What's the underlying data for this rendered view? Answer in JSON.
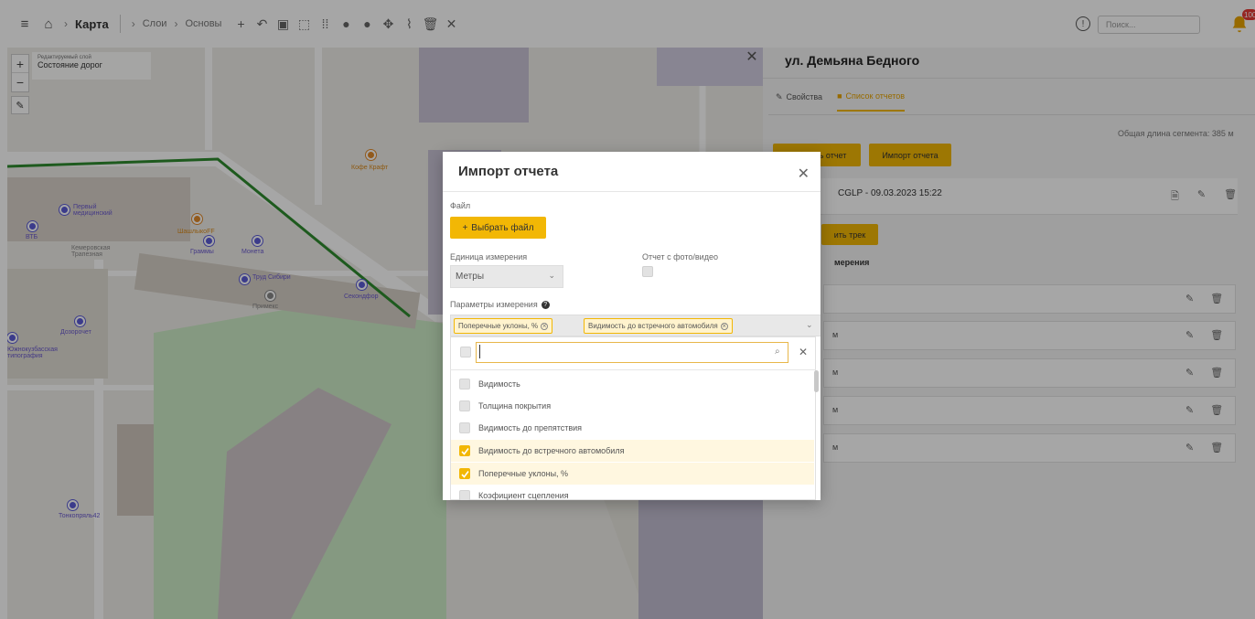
{
  "topbar": {
    "breadcrumb": [
      {
        "label": "Карта",
        "bold": true
      },
      {
        "label": "Слои",
        "bold": false
      },
      {
        "label": "Основы",
        "bold": false
      }
    ],
    "search_placeholder": "Поиск...",
    "notifications_badge": "100",
    "tool_icons": [
      "plus-icon",
      "undo-icon",
      "save-icon",
      "select-rect-icon",
      "grid-icon",
      "point-icon",
      "point-filled-icon",
      "move-icon",
      "line-icon",
      "delete-icon",
      "close-icon"
    ]
  },
  "map": {
    "layer_caption": "Редактируемый слой",
    "layer_name": "Состояние дорог",
    "labels": {
      "kofe": "Кофе Крафт",
      "vtb": "ВТБ",
      "pervyi": "Первый медицинский",
      "shashlykoff": "ШашлыкоFF",
      "gramm": "Граммы",
      "mosfera": "Монета",
      "kemerovskaya": "Кемеровская Трапезная",
      "trud_sibiri": "Труд Сибири",
      "sekonds": "Секондфор",
      "dozorochet": "Дозорочет",
      "yuzhnaya": "Южнокузбасская типография",
      "tonkopryal": "Тонкопряль42",
      "primeks": "Примекс"
    }
  },
  "panel": {
    "title": "ул. Демьяна Бедного",
    "tabs": [
      {
        "label": "Свойства",
        "active": false
      },
      {
        "label": "Список отчетов",
        "active": true
      }
    ],
    "total_length": "Общая длина сегмента: 385 м",
    "add_report_btn": "Добавить отчет",
    "import_report_btn": "Импорт отчета",
    "report_title": "CGLP - 09.03.2023 15:22",
    "add_track_btn": "ить трек",
    "section_title": "мерения",
    "rows": [
      {
        "text": ""
      },
      {
        "text": "м"
      },
      {
        "text": "м"
      },
      {
        "text": "м"
      },
      {
        "text": "м"
      }
    ]
  },
  "modal": {
    "title": "Импорт отчета",
    "file_label": "Файл",
    "choose_file_btn": "Выбрать файл",
    "unit_label": "Единица измерения",
    "unit_value": "Метры",
    "photo_label": "Отчет с фото/видео",
    "params_label": "Параметры измерения",
    "tags": [
      "Поперечные уклоны, %",
      "Видимость до встречного автомобиля"
    ],
    "options": [
      {
        "label": "Видимость",
        "checked": false
      },
      {
        "label": "Толщина покрытия",
        "checked": false
      },
      {
        "label": "Видимость до препятствия",
        "checked": false
      },
      {
        "label": "Видимость до встречного автомобиля",
        "checked": true
      },
      {
        "label": "Поперечные уклоны, %",
        "checked": true
      },
      {
        "label": "Коэфициент сцепления",
        "checked": false
      }
    ]
  },
  "colors": {
    "accent": "#f2b705",
    "route": "#2e8b2e"
  }
}
